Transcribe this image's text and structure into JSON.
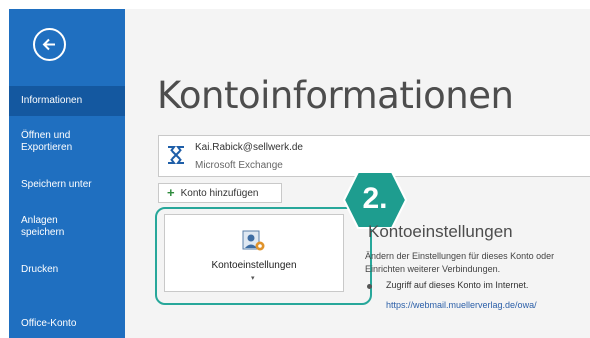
{
  "sidebar": {
    "items": [
      {
        "label": "Informationen"
      },
      {
        "label": "Öffnen und\nExportieren"
      },
      {
        "label": "Speichern unter"
      },
      {
        "label": "Anlagen\nspeichern"
      },
      {
        "label": "Drucken"
      },
      {
        "label": "Office-Konto"
      }
    ]
  },
  "main": {
    "title": "Kontoinformationen",
    "account": {
      "email": "Kai.Rabick@sellwerk.de",
      "type": "Microsoft Exchange"
    },
    "add_account_label": "Konto hinzufügen",
    "settings_tile": {
      "label": "Kontoeinstellungen",
      "caret": "▾"
    },
    "step_badge": "2.",
    "settings_section": {
      "title": "Kontoeinstellungen",
      "description": "Ändern der Einstellungen für dieses Konto oder Einrichten weiterer Verbindungen.",
      "bullet": "Zugriff auf dieses Konto im Internet.",
      "link": "https://webmail.muellerverlag.de/owa/"
    }
  },
  "colors": {
    "sidebar": "#1f6fc0",
    "sidebar_active": "#1458a0",
    "highlight": "#27a79a",
    "badge": "#1e9d8f"
  }
}
